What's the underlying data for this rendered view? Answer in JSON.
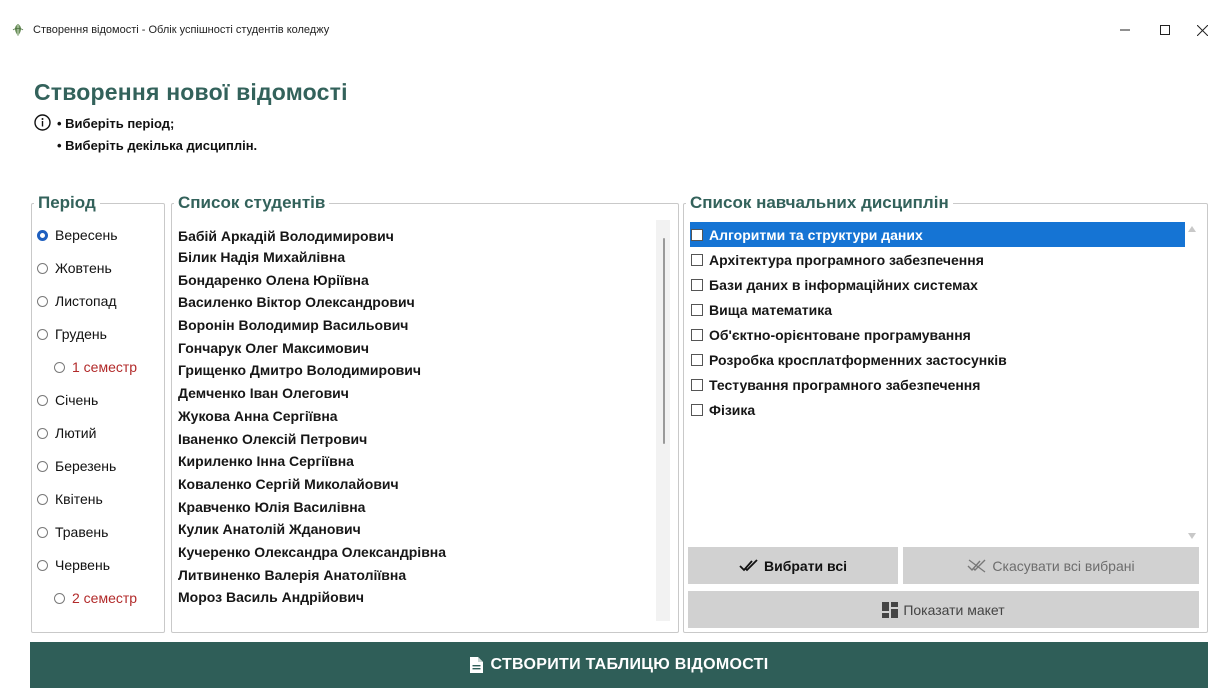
{
  "window": {
    "title": "Створення відомості - Облік успішності студентів коледжу",
    "minimize_glyph": "−",
    "maximize_glyph": "☐",
    "close_glyph": "✕"
  },
  "page": {
    "title": "Створення нової відомості",
    "hints": [
      "• Виберіть період;",
      "• Виберіть декілька дисциплін."
    ]
  },
  "period": {
    "legend": "Період",
    "items": [
      {
        "label": "Вересень",
        "checked": true,
        "semester": false
      },
      {
        "label": "Жовтень",
        "checked": false,
        "semester": false
      },
      {
        "label": "Листопад",
        "checked": false,
        "semester": false
      },
      {
        "label": "Грудень",
        "checked": false,
        "semester": false
      },
      {
        "label": "1 семестр",
        "checked": false,
        "semester": true
      },
      {
        "label": "Січень",
        "checked": false,
        "semester": false
      },
      {
        "label": "Лютий",
        "checked": false,
        "semester": false
      },
      {
        "label": "Березень",
        "checked": false,
        "semester": false
      },
      {
        "label": "Квітень",
        "checked": false,
        "semester": false
      },
      {
        "label": "Травень",
        "checked": false,
        "semester": false
      },
      {
        "label": "Червень",
        "checked": false,
        "semester": false
      },
      {
        "label": "2 семестр",
        "checked": false,
        "semester": true
      }
    ]
  },
  "students": {
    "legend": "Список студентів",
    "items": [
      "Бабій Аркадій Володимирович",
      "Білик Надія Михайлівна",
      "Бондаренко Олена Юріївна",
      "Василенко Віктор Олександрович",
      "Воронін Володимир Васильович",
      "Гончарук Олег Максимович",
      "Грищенко Дмитро Володимирович",
      "Демченко Іван Олегович",
      "Жукова Анна Сергіївна",
      "Іваненко Олексій Петрович",
      "Кириленко Інна Сергіївна",
      "Коваленко Сергій Миколайович",
      "Кравченко Юлія Василівна",
      "Кулик Анатолій Жданович",
      "Кучеренко Олександра Олександрівна",
      "Литвиненко Валерія Анатоліївна",
      "Мороз Василь Андрійович"
    ]
  },
  "disciplines": {
    "legend": "Список навчальних дисциплін",
    "items": [
      {
        "label": "Алгоритми та структури даних",
        "selected": true
      },
      {
        "label": "Архітектура програмного забезпечення",
        "selected": false
      },
      {
        "label": "Бази даних в інформаційних системах",
        "selected": false
      },
      {
        "label": "Вища математика",
        "selected": false
      },
      {
        "label": "Об'єктно-орієнтоване програмування",
        "selected": false
      },
      {
        "label": "Розробка кросплатформенних застосунків",
        "selected": false
      },
      {
        "label": "Тестування програмного забезпечення",
        "selected": false
      },
      {
        "label": "Фізика",
        "selected": false
      }
    ]
  },
  "buttons": {
    "select_all": "Вибрати всі",
    "clear_all": "Скасувати всі вибрані",
    "show_layout": "Показати макет",
    "create_table": "СТВОРИТИ ТАБЛИЦЮ ВІДОМОСТІ"
  },
  "colors": {
    "accent": "#33625b",
    "primary_button": "#2f5e58",
    "selection": "#1574d4",
    "semester_text": "#b22a2a",
    "secondary_button": "#d1d1d1"
  },
  "icons": {
    "app": "leaf-icon",
    "info": "info-circle-icon",
    "select_all": "double-check-icon",
    "clear_all": "uncheck-all-icon",
    "layout": "grid-layout-icon",
    "create": "document-icon"
  }
}
